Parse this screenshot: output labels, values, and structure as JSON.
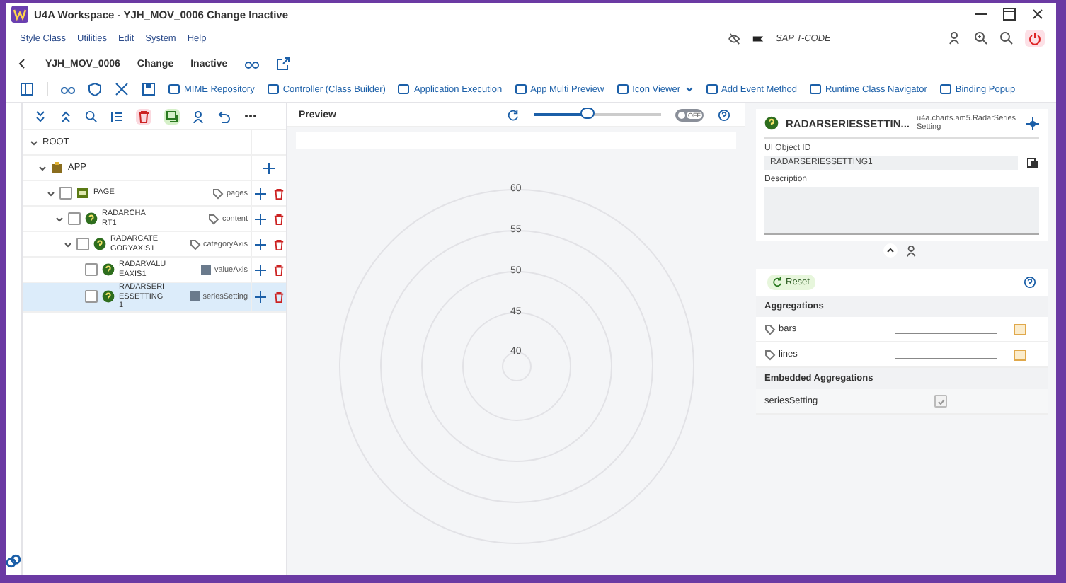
{
  "window": {
    "title": "U4A Workspace - YJH_MOV_0006 Change Inactive"
  },
  "menu": [
    "Style Class",
    "Utilities",
    "Edit",
    "System",
    "Help"
  ],
  "tcode": {
    "placeholder": "SAP T-CODE"
  },
  "header": {
    "app_id": "YJH_MOV_0006",
    "mode": "Change",
    "status": "Inactive"
  },
  "toolbar": [
    {
      "label": "MIME Repository",
      "dropdown": false
    },
    {
      "label": "Controller (Class Builder)",
      "dropdown": false
    },
    {
      "label": "Application Execution",
      "dropdown": false
    },
    {
      "label": "App Multi Preview",
      "dropdown": false
    },
    {
      "label": "Icon Viewer",
      "dropdown": true
    },
    {
      "label": "Add Event Method",
      "dropdown": false
    },
    {
      "label": "Runtime Class Navigator",
      "dropdown": false
    },
    {
      "label": "Binding Popup",
      "dropdown": false
    }
  ],
  "tree": [
    {
      "label": "ROOT",
      "kind": "root",
      "expanded": true,
      "selected": false,
      "children": [
        {
          "label": "APP",
          "kind": "app",
          "expanded": true,
          "selected": false,
          "children": [
            {
              "label": "PAGE",
              "kind": "page",
              "expanded": true,
              "selected": false,
              "checked": false,
              "aggregation": {
                "name": "pages",
                "kind": "multiple"
              },
              "children": [
                {
                  "label": "RADARCHART1",
                  "kind": "control",
                  "expanded": true,
                  "selected": false,
                  "checked": false,
                  "aggregation": {
                    "name": "content",
                    "kind": "multiple"
                  },
                  "children": [
                    {
                      "label": "RADARCATEGORYAXIS1",
                      "kind": "control",
                      "expanded": true,
                      "selected": false,
                      "checked": false,
                      "aggregation": {
                        "name": "categoryAxis",
                        "kind": "multiple"
                      },
                      "children": [
                        {
                          "label": "RADARVALUEAXIS1",
                          "kind": "control",
                          "selected": false,
                          "checked": false,
                          "aggregation": {
                            "name": "valueAxis",
                            "kind": "single"
                          }
                        },
                        {
                          "label": "RADARSERIESSETTING1",
                          "kind": "control",
                          "selected": true,
                          "checked": false,
                          "aggregation": {
                            "name": "seriesSetting",
                            "kind": "single"
                          }
                        }
                      ]
                    }
                  ]
                }
              ]
            }
          ]
        }
      ]
    }
  ],
  "preview": {
    "title": "Preview",
    "zoom": {
      "level": 0.42
    },
    "switch": {
      "label": "OFF",
      "on": false
    },
    "axis_labels": [
      "60",
      "55",
      "50",
      "45",
      "40"
    ]
  },
  "properties": {
    "title": "RADARSERIESSETTIN...",
    "class_name": "u4a.charts.am5.RadarSeriesSetting",
    "object_id_label": "UI Object ID",
    "object_id": "RADARSERIESSETTING1",
    "description_label": "Description",
    "reset": "Reset",
    "sections": [
      {
        "title": "Aggregations",
        "rows": [
          {
            "name": "bars",
            "kind": "aggregation"
          },
          {
            "name": "lines",
            "kind": "aggregation"
          }
        ]
      },
      {
        "title": "Embedded Aggregations",
        "rows": [
          {
            "name": "seriesSetting",
            "kind": "embedded",
            "checked": true
          }
        ]
      }
    ]
  }
}
